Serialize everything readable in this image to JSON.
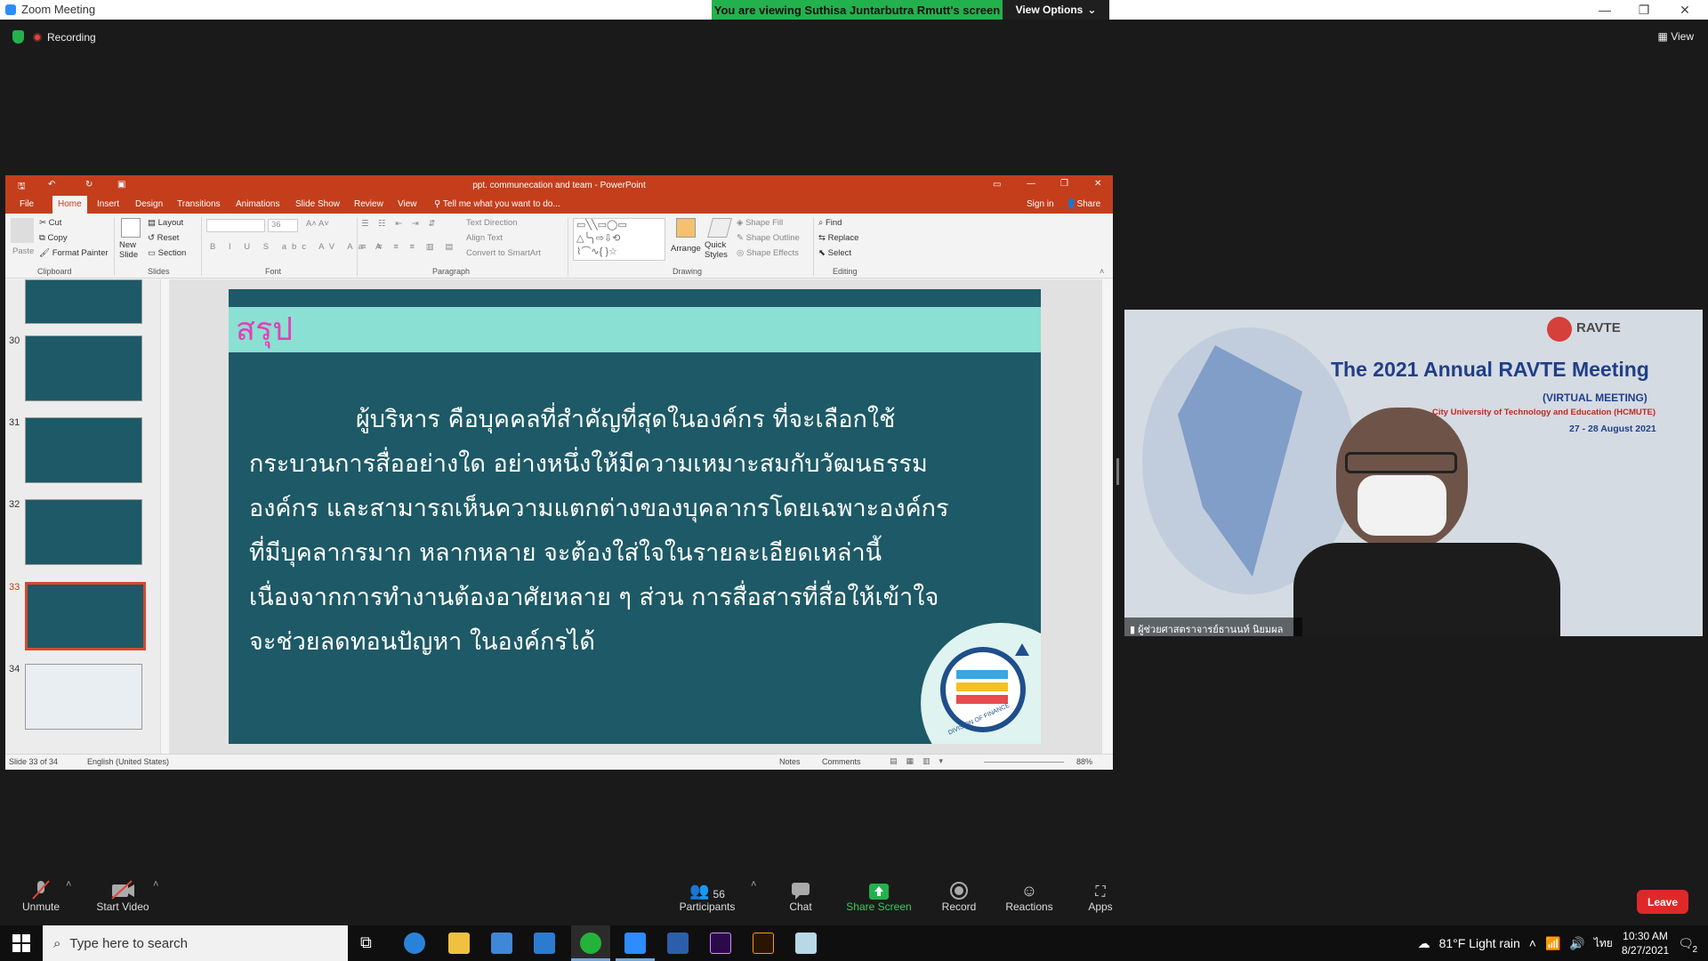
{
  "zoom": {
    "window_title": "Zoom Meeting",
    "viewing_banner": "You are viewing Suthisa  Juntarbutra Rmutt's screen",
    "view_options": "View Options",
    "recording": "Recording",
    "view": "View"
  },
  "ppt": {
    "title": "ppt. communecation and team  -  PowerPoint",
    "tabs": [
      "File",
      "Home",
      "Insert",
      "Design",
      "Transitions",
      "Animations",
      "Slide Show",
      "Review",
      "View"
    ],
    "tell_me": "Tell me what you want to do...",
    "sign_in": "Sign in",
    "share": "Share",
    "clipboard": {
      "paste": "Paste",
      "cut": "Cut",
      "copy": "Copy",
      "format_painter": "Format Painter",
      "label": "Clipboard"
    },
    "slides": {
      "new_slide": "New Slide",
      "layout": "Layout",
      "reset": "Reset",
      "section": "Section",
      "label": "Slides"
    },
    "font": {
      "size": "36",
      "label": "Font"
    },
    "paragraph": {
      "text_direction": "Text Direction",
      "align_text": "Align Text",
      "convert": "Convert to SmartArt",
      "label": "Paragraph"
    },
    "drawing": {
      "arrange": "Arrange",
      "quick_styles": "Quick Styles",
      "shape_fill": "Shape Fill",
      "shape_outline": "Shape Outline",
      "shape_effects": "Shape Effects",
      "label": "Drawing"
    },
    "editing": {
      "find": "Find",
      "replace": "Replace",
      "select": "Select",
      "label": "Editing"
    },
    "thumbnails": [
      "30",
      "31",
      "32",
      "33",
      "34"
    ],
    "slide": {
      "title": "สรุป",
      "lines": [
        "ผู้บริหาร คือบุคคลที่สำคัญที่สุดในองค์กร ที่จะเลือกใช้",
        "กระบวนการสื่ออย่างใด อย่างหนึ่งให้มีความเหมาะสมกับวัฒนธรรม",
        "องค์กร และสามารถเห็นความแตกต่างของบุคลากรโดยเฉพาะองค์กร",
        "ที่มีบุคลากรมาก หลากหลาย จะต้องใส่ใจในรายละเอียดเหล่านี้",
        "เนื่องจากการทำงานต้องอาศัยหลาย ๆ ส่วน การสื่อสารที่สื่อให้เข้าใจ",
        "จะช่วยลดทอนปัญหา ในองค์กรได้"
      ],
      "logo_text": "DIVISION OF FINANCE"
    },
    "status": {
      "slide": "Slide 33 of 34",
      "lang": "English (United States)",
      "notes": "Notes",
      "comments": "Comments",
      "zoom": "88%"
    }
  },
  "video": {
    "heading": "The 2021 Annual RAVTE Meeting",
    "sub": "(VIRTUAL MEETING)",
    "org": "City University of Technology and Education (HCMUTE)",
    "date": "27 - 28 August 2021",
    "logo": "RAVTE",
    "participant_name": "ผู้ช่วยศาสตราจารย์ธานนท์ นิยมผล"
  },
  "toolbar": {
    "unmute": "Unmute",
    "start_video": "Start Video",
    "participants": "Participants",
    "participant_count": "56",
    "chat": "Chat",
    "share_screen": "Share Screen",
    "record": "Record",
    "reactions": "Reactions",
    "apps": "Apps",
    "leave": "Leave"
  },
  "taskbar": {
    "search": "Type here to search",
    "weather": "81°F  Light rain",
    "lang": "ไทย",
    "time": "10:30 AM",
    "date": "8/27/2021",
    "notifications": "2"
  }
}
